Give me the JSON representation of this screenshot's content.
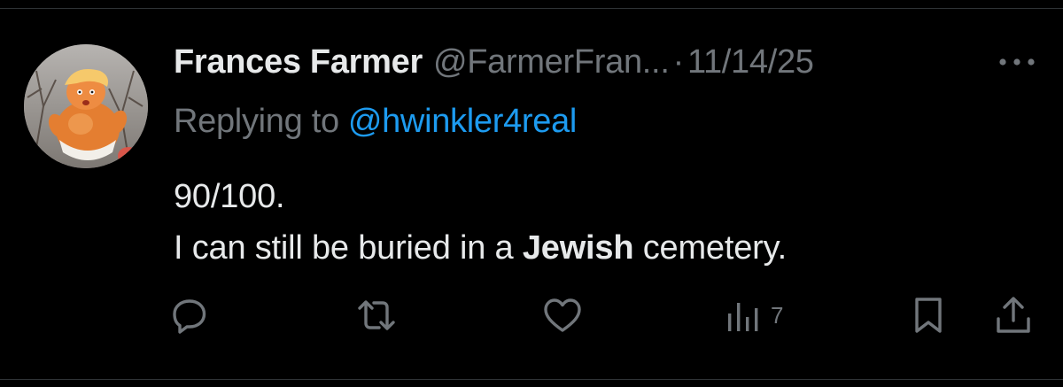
{
  "tweet": {
    "author": {
      "display_name": "Frances Farmer",
      "handle": "@FarmerFran...",
      "separator": "·",
      "date": "11/14/25"
    },
    "reply": {
      "prefix": "Replying to",
      "handle": "@hwinkler4real"
    },
    "body": {
      "line1": "90/100.",
      "line2_before": "I can still be buried in a ",
      "line2_bold": "Jewish",
      "line2_after": " cemetery."
    },
    "actions": {
      "views_count": "7"
    }
  },
  "icons": {
    "more": "more-horizontal-icon",
    "reply": "speech-bubble-icon",
    "retweet": "retweet-arrows-icon",
    "like": "heart-icon",
    "views": "bar-chart-icon",
    "bookmark": "bookmark-icon",
    "share": "share-upload-icon"
  },
  "colors": {
    "background": "#000000",
    "primary_text": "#e7e9ea",
    "secondary_text": "#71767b",
    "link": "#1d9bf0"
  }
}
